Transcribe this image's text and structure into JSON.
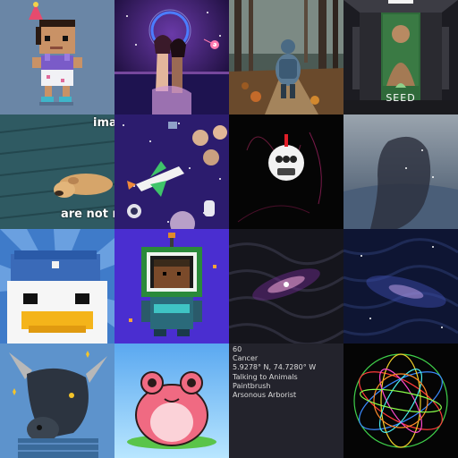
{
  "tiles": [
    {
      "name": "party-girl-pixel"
    },
    {
      "name": "neon-couple-lake"
    },
    {
      "name": "hiker-forest"
    },
    {
      "name": "seed-elevator",
      "caption": "SEED"
    },
    {
      "name": "sleeping-dog-meme",
      "caption_top": "ima",
      "caption_bottom": "are not re"
    },
    {
      "name": "space-shuttle-collage"
    },
    {
      "name": "skull-mask-dark"
    },
    {
      "name": "hair-silhouette-landscape"
    },
    {
      "name": "duck-sailor-pixel"
    },
    {
      "name": "astronaut-pixel"
    },
    {
      "name": "deepdream-galaxy-1"
    },
    {
      "name": "deepdream-galaxy-2"
    },
    {
      "name": "bull-portrait"
    },
    {
      "name": "pink-frog-cartoon"
    },
    {
      "name": "traits-text",
      "traits": [
        "60",
        "Cancer",
        "5.9278° N, 74.7280° W",
        "Talking to Animals",
        "Paintbrush",
        "Arsonous Arborist"
      ]
    },
    {
      "name": "neon-wire-sphere"
    }
  ],
  "colors": {
    "slate": "#6a86a6",
    "night": "#1a1040",
    "forest": "#4b5a54",
    "elevator": "#2a2a30",
    "teal_wood": "#2f5a62",
    "space_purple": "#2c1c6e",
    "black": "#050505",
    "haze": "#6b7f96",
    "sunburst_blue": "#3f7bc9",
    "violet": "#4a2ed0",
    "dark_swirl": "#15151c",
    "deep_blue": "#0e1533",
    "sky_blue": "#5d93cc",
    "sky_light": "#8fd0ff",
    "text_tile": "#23232c"
  }
}
